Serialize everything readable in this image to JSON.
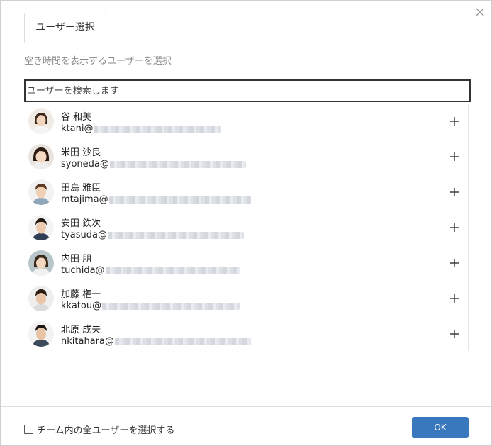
{
  "dialog": {
    "tab_label": "ユーザー選択",
    "instruction": "空き時間を表示するユーザーを選択",
    "search_placeholder": "ユーザーを検索します",
    "select_all_label": "チーム内の全ユーザーを選択する",
    "ok_label": "OK",
    "accent_color": "#3a78bd"
  },
  "users": [
    {
      "name": "谷 和美",
      "email_prefix": "ktani@"
    },
    {
      "name": "米田 沙良",
      "email_prefix": "syoneda@"
    },
    {
      "name": "田島 雅臣",
      "email_prefix": "mtajima@"
    },
    {
      "name": "安田 鉄次",
      "email_prefix": "tyasuda@"
    },
    {
      "name": "内田 朋",
      "email_prefix": "tuchida@"
    },
    {
      "name": "加藤 権一",
      "email_prefix": "kkatou@"
    },
    {
      "name": "北原 成夫",
      "email_prefix": "nkitahara@"
    }
  ],
  "icons": {
    "close": "close-icon",
    "add": "plus-icon",
    "avatar": "avatar-photo"
  }
}
